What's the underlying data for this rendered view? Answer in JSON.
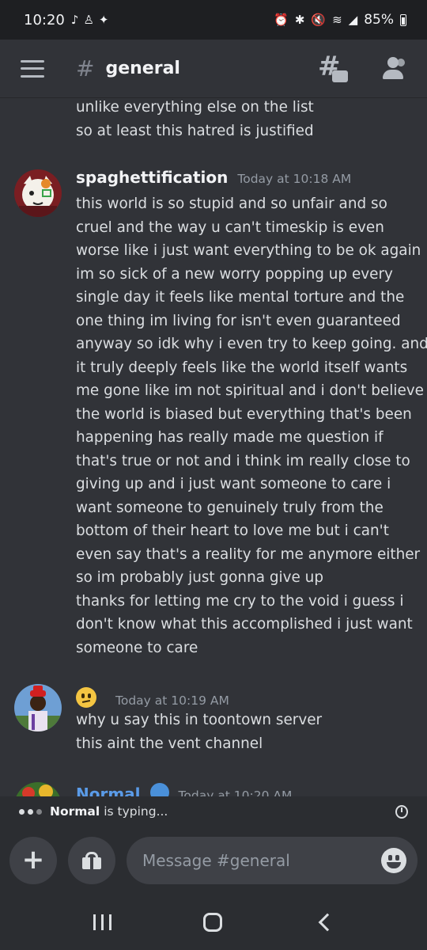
{
  "status_bar": {
    "time": "10:20",
    "battery": "85%",
    "left_icons": [
      "tiktok-icon",
      "person-add-icon",
      "twitter-icon"
    ],
    "right_icons": [
      "alarm-icon",
      "bluetooth-icon",
      "mute-icon",
      "wifi-icon",
      "signal-icon"
    ]
  },
  "header": {
    "channel_name": "general",
    "hash_symbol": "#"
  },
  "messages": {
    "continued_lines": [
      "unlike everything else on the list",
      "so at least this hatred is justified"
    ],
    "groups": [
      {
        "author": "spaghettification",
        "timestamp": "Today at 10:18 AM",
        "lines": [
          "this world is so stupid and so unfair and so",
          "cruel and the way u can't timeskip is even",
          "worse like i just want everything to be ok again",
          "im so sick of a new worry popping up every",
          "single day it feels like mental torture and the",
          "one thing im living for isn't even guaranteed",
          "anyway so idk why i even try to keep going. and",
          "it truly deeply feels like the world itself wants",
          "me gone like im not spiritual and i don't believe",
          "the world is biased but everything that's been",
          "happening has really made me question if",
          "that's true or not and i think im really close to",
          "giving up and i just want someone to care i",
          "want someone to genuinely truly from the",
          "bottom of their heart to love me but i can't",
          "even say that's a reality for me anymore either",
          "so im probably just gonna give up",
          "thanks for letting me cry to the void i guess i",
          "don't know what this accomplished i just want",
          "someone to care"
        ]
      },
      {
        "author": "",
        "timestamp": "Today at 10:19 AM",
        "lines": [
          "why u say this in toontown server",
          "this aint the vent channel"
        ]
      },
      {
        "author": "Normal",
        "timestamp": "Today at 10:20 AM",
        "lines": []
      }
    ]
  },
  "typing": {
    "name": "Normal",
    "text": "is typing..."
  },
  "composer": {
    "placeholder": "Message #general"
  },
  "colors": {
    "background": "#313338",
    "header_bg": "#1e1f22",
    "composer_bg": "#2b2d31",
    "text": "#dbdee1",
    "muted": "#949ba4",
    "author_blue": "#5a9be8"
  }
}
